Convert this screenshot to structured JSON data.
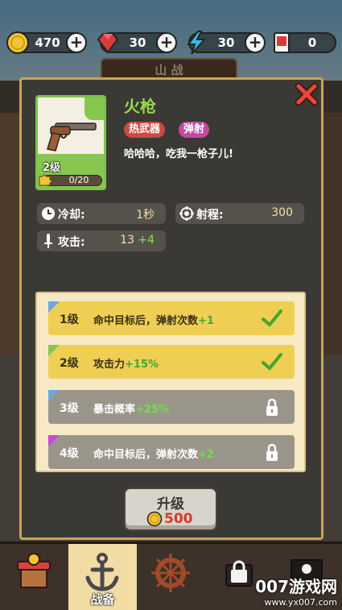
{
  "currency": [
    {
      "icon": "gold-coin-icon",
      "value": "470"
    },
    {
      "icon": "red-gem-icon",
      "value": "30"
    },
    {
      "icon": "energy-bolt-icon",
      "value": "30"
    },
    {
      "icon": "red-envelope-icon",
      "value": "0"
    }
  ],
  "background": {
    "tab_title": "山 战"
  },
  "weapon": {
    "name": "火枪",
    "level": "2级",
    "shards": "0/20",
    "shards_fraction": 0.0,
    "tags": [
      "热武器",
      "弹射"
    ],
    "description": "哈哈哈，吃我一枪子儿!"
  },
  "stats": {
    "cooldown": {
      "label": "冷却:",
      "value": "1秒"
    },
    "range": {
      "label": "射程:",
      "value": "300"
    },
    "attack": {
      "label": "攻击:",
      "value": "13",
      "bonus": "+4"
    }
  },
  "levels": [
    {
      "level": "1级",
      "text": "命中目标后，弹射次数",
      "bonus": "+1",
      "unlocked": true,
      "color": "#6ea7e0"
    },
    {
      "level": "2级",
      "text": "攻击力",
      "bonus": "+15%",
      "unlocked": true,
      "color": "#86c74e"
    },
    {
      "level": "3级",
      "text": "暴击概率",
      "bonus": "+25%",
      "unlocked": false,
      "color": "#6ea7e0"
    },
    {
      "level": "4级",
      "text": "命中目标后，弹射次数",
      "bonus": "+2",
      "unlocked": false,
      "color": "#c84ad6"
    }
  ],
  "upgrade": {
    "label": "升级",
    "cost": "500"
  },
  "nav": [
    {
      "label": "",
      "icon": "shop-stall-icon",
      "active": false
    },
    {
      "label": "战备",
      "icon": "anchor-icon",
      "active": true
    },
    {
      "label": "",
      "icon": "ship-wheel-icon",
      "active": false
    },
    {
      "label": "",
      "icon": "locked-icon",
      "active": false
    },
    {
      "label": "",
      "icon": "pirate-flag-icon",
      "active": false
    }
  ],
  "watermark": {
    "title": "007游戏网",
    "url": "www.yx007.com"
  },
  "colors": {
    "accent_green": "#97d94b",
    "gold": "#c9a35c",
    "close_red": "#e8473a"
  }
}
